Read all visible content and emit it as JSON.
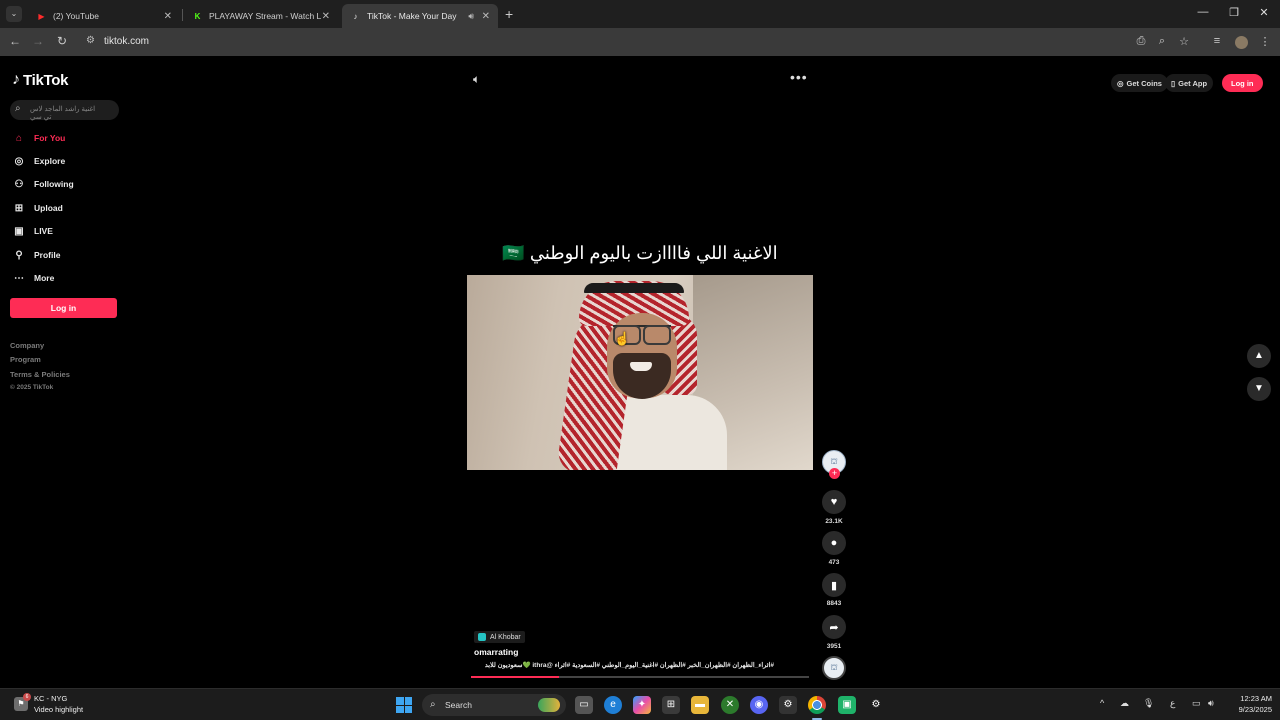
{
  "browser": {
    "tabs": [
      {
        "label": "(2) YouTube",
        "icon": "youtube-icon",
        "active": false
      },
      {
        "label": "PLAYAWAY Stream - Watch Live",
        "icon": "kick-icon",
        "active": false
      },
      {
        "label": "TikTok - Make Your Day",
        "icon": "tiktok-icon",
        "active": true
      }
    ],
    "new_tab": "+",
    "url": "tiktok.com"
  },
  "sidebar": {
    "logo": "TikTok",
    "search_placeholder": "اغنية راشد الماجد لاس تي سي",
    "nav": [
      {
        "label": "For You",
        "icon": "home-icon",
        "active": true
      },
      {
        "label": "Explore",
        "icon": "compass-icon",
        "active": false
      },
      {
        "label": "Following",
        "icon": "following-icon",
        "active": false
      },
      {
        "label": "Upload",
        "icon": "upload-icon",
        "active": false
      },
      {
        "label": "LIVE",
        "icon": "live-icon",
        "active": false
      },
      {
        "label": "Profile",
        "icon": "profile-icon",
        "active": false
      },
      {
        "label": "More",
        "icon": "more-icon",
        "active": false
      }
    ],
    "login_label": "Log in",
    "footer": [
      "Company",
      "Program",
      "Terms & Policies"
    ],
    "copyright": "© 2025 TikTok"
  },
  "header": {
    "get_coins": "Get Coins",
    "get_app": "Get App",
    "login": "Log in"
  },
  "video": {
    "overlay_title": "الاغنية اللي فاااازت باليوم الوطني 🇸🇦",
    "location": "Al Khobar",
    "username": "omarrating",
    "hashtags": "#اثراء_الظهران #الظهران_الخبر #الظهران #اغنية_اليوم_الوطني #السعودية #اثراء @ithra 💚سعوديون للابد",
    "progress": 0.26,
    "stats": {
      "likes": "23.1K",
      "comments": "473",
      "saves": "8843",
      "shares": "3951"
    }
  },
  "taskbar": {
    "weather_line1": "KC - NYG",
    "weather_line2": "Video highlight",
    "weather_badge": "6",
    "search_label": "Search",
    "time": "12:23 AM",
    "date": "9/23/2025",
    "lang": "ع"
  },
  "colors": {
    "accent": "#fe2c55",
    "background": "#000000",
    "chrome_dark": "#1f1f1f",
    "chrome_toolbar": "#3a3a3a"
  }
}
